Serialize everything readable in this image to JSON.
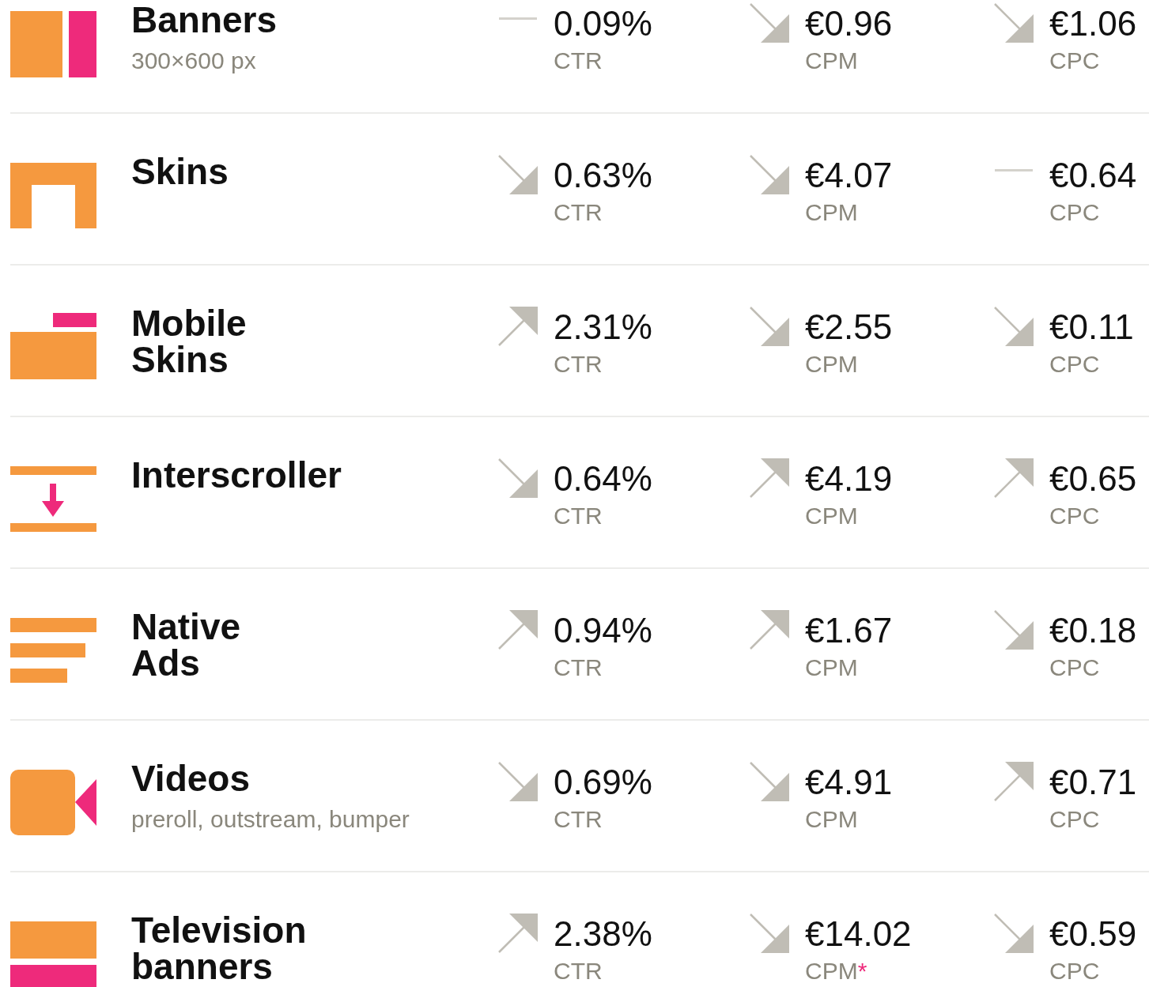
{
  "rows": [
    {
      "kind": "banners",
      "name": "Banners",
      "subtitle": "300×600 px",
      "metrics": [
        {
          "kind": "flat",
          "value": "0.09%",
          "label": "CTR"
        },
        {
          "kind": "down",
          "value": "€0.96",
          "label": "CPM"
        },
        {
          "kind": "down",
          "value": "€1.06",
          "label": "CPC"
        }
      ]
    },
    {
      "kind": "skins",
      "name": "Skins",
      "metrics": [
        {
          "kind": "down",
          "value": "0.63%",
          "label": "CTR"
        },
        {
          "kind": "down",
          "value": "€4.07",
          "label": "CPM"
        },
        {
          "kind": "flat",
          "value": "€0.64",
          "label": "CPC"
        }
      ]
    },
    {
      "kind": "mobile-skins",
      "name": "Mobile\nSkins",
      "metrics": [
        {
          "kind": "up",
          "value": "2.31%",
          "label": "CTR"
        },
        {
          "kind": "down",
          "value": "€2.55",
          "label": "CPM"
        },
        {
          "kind": "down",
          "value": "€0.11",
          "label": "CPC"
        }
      ]
    },
    {
      "kind": "interscroller",
      "name": "Interscroller",
      "metrics": [
        {
          "kind": "down",
          "value": "0.64%",
          "label": "CTR"
        },
        {
          "kind": "up",
          "value": "€4.19",
          "label": "CPM"
        },
        {
          "kind": "up",
          "value": "€0.65",
          "label": "CPC"
        }
      ]
    },
    {
      "kind": "native",
      "name": "Native\nAds",
      "metrics": [
        {
          "kind": "up",
          "value": "0.94%",
          "label": "CTR"
        },
        {
          "kind": "up",
          "value": "€1.67",
          "label": "CPM"
        },
        {
          "kind": "down",
          "value": "€0.18",
          "label": "CPC"
        }
      ]
    },
    {
      "kind": "video",
      "name": "Videos",
      "subtitle": "preroll, outstream, bumper",
      "metrics": [
        {
          "kind": "down",
          "value": "0.69%",
          "label": "CTR"
        },
        {
          "kind": "down",
          "value": "€4.91",
          "label": "CPM"
        },
        {
          "kind": "up",
          "value": "€0.71",
          "label": "CPC"
        }
      ]
    },
    {
      "kind": "tv",
      "name": "Television\nbanners",
      "metrics": [
        {
          "kind": "up",
          "value": "2.38%",
          "label": "CTR"
        },
        {
          "kind": "down",
          "value": "€14.02",
          "label": "CPM",
          "note": "*"
        },
        {
          "kind": "down",
          "value": "€0.59",
          "label": "CPC"
        }
      ]
    }
  ]
}
